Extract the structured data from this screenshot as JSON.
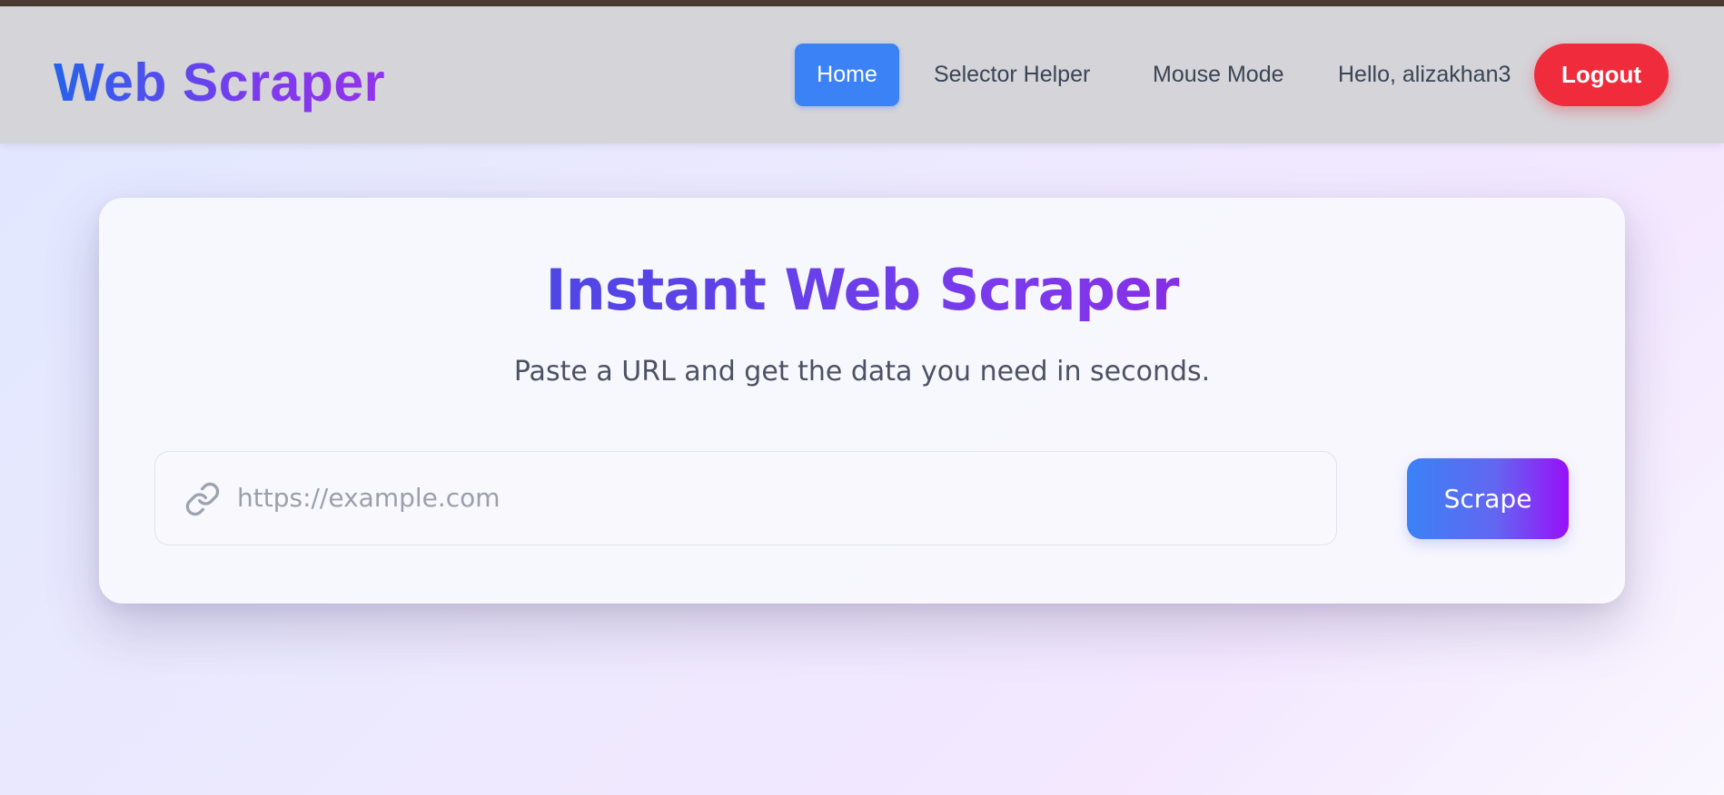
{
  "app": {
    "brand": "Web Scraper",
    "top_strip_color": "#4a3b33"
  },
  "nav": {
    "links": [
      {
        "label": "Home",
        "active": true
      },
      {
        "label": "Selector Helper",
        "active": false
      },
      {
        "label": "Mouse Mode",
        "active": false
      }
    ],
    "greeting": "Hello, alizakhan3",
    "logout_label": "Logout"
  },
  "main": {
    "title": "Instant Web Scraper",
    "subtitle": "Paste a URL and get the data you need in seconds.",
    "url_input": {
      "value": "",
      "placeholder": "https://example.com",
      "icon": "link-icon"
    },
    "scrape_label": "Scrape"
  },
  "colors": {
    "nav_active": "#3b82f6",
    "logout": "#ef2b3c",
    "brand_gradient": [
      "#2563eb",
      "#9333ea"
    ],
    "button_gradient": [
      "#3b82f6",
      "#9810fa"
    ]
  }
}
